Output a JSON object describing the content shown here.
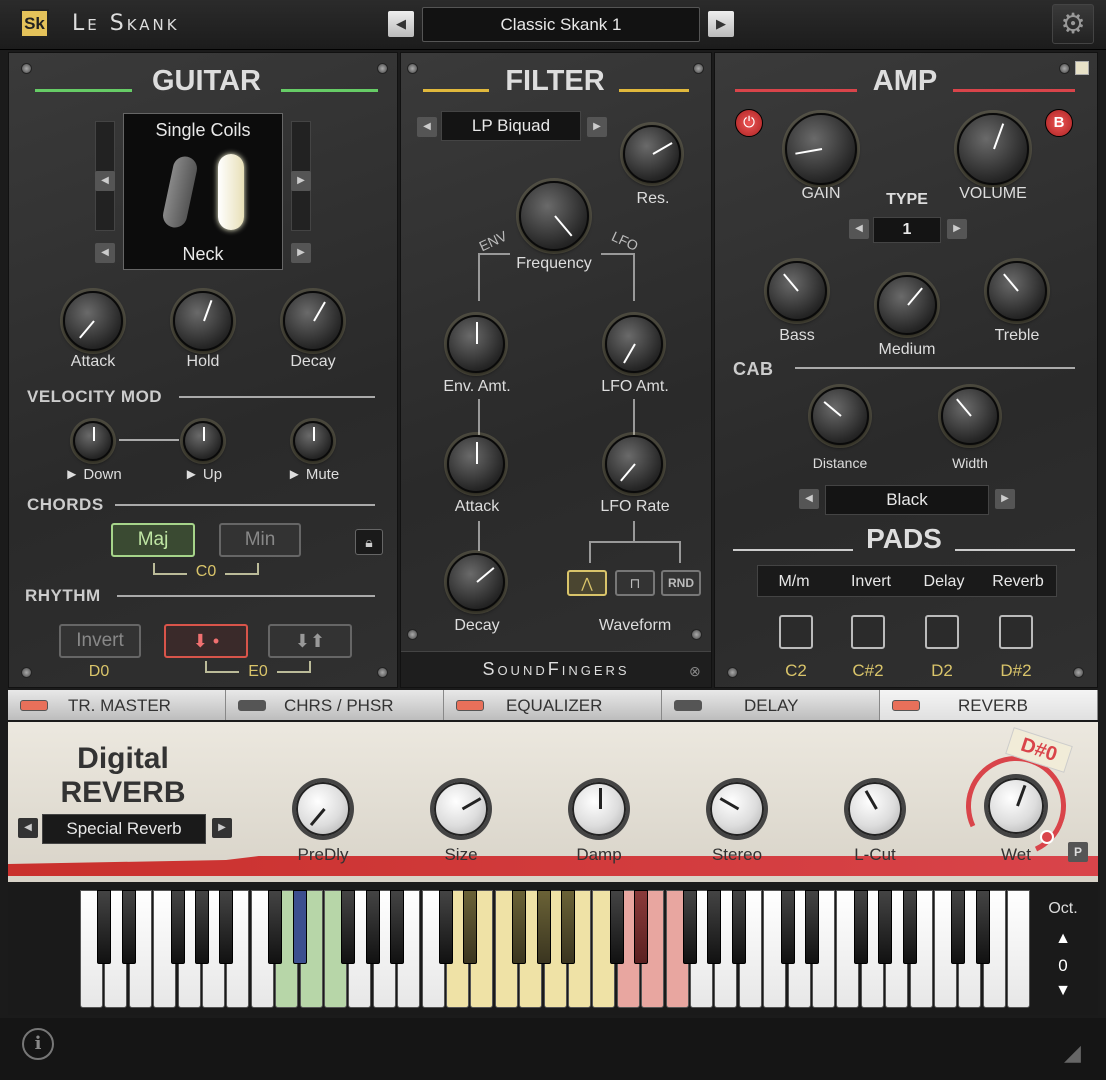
{
  "header": {
    "logo": "Sk",
    "app_title": "Le Skank",
    "preset": "Classic Skank 1",
    "prev": "◀",
    "next": "▶",
    "gear_icon": "gear-icon"
  },
  "guitar": {
    "title": "GUITAR",
    "pickup_type": "Single Coils",
    "pickup_position": "Neck",
    "knobs": [
      {
        "label": "Attack"
      },
      {
        "label": "Hold"
      },
      {
        "label": "Decay"
      }
    ],
    "velocity_mod": {
      "title": "VELOCITY MOD",
      "items": [
        "► Down",
        "► Up",
        "► Mute"
      ]
    },
    "chords": {
      "title": "CHORDS",
      "maj": "Maj",
      "min": "Min",
      "key": "C0"
    },
    "rhythm": {
      "title": "RHYTHM",
      "invert": "Invert",
      "invert_key": "D0",
      "strum_key": "E0"
    }
  },
  "filter": {
    "title": "FILTER",
    "type": "LP Biquad",
    "res": "Res.",
    "frequency": "Frequency",
    "env": "ENV",
    "lfo": "LFO",
    "env_amt": "Env. Amt.",
    "lfo_amt": "LFO Amt.",
    "attack": "Attack",
    "lfo_rate": "LFO Rate",
    "decay": "Decay",
    "waveform": "Waveform",
    "rnd": "RND",
    "brand": "SoundFingers"
  },
  "amp": {
    "title": "AMP",
    "b": "B",
    "gain": "GAIN",
    "volume": "VOLUME",
    "type_label": "TYPE",
    "type_value": "1",
    "bass": "Bass",
    "medium": "Medium",
    "treble": "Treble",
    "cab": "CAB",
    "distance": "Distance",
    "width": "Width",
    "cab_value": "Black"
  },
  "pads": {
    "title": "PADS",
    "tabs": [
      "M/m",
      "Invert",
      "Delay",
      "Reverb"
    ],
    "keys": [
      "C2",
      "C#2",
      "D2",
      "D#2"
    ]
  },
  "fx_tabs": [
    {
      "label": "TR. MASTER",
      "on": true
    },
    {
      "label": "CHRS / PHSR",
      "on": false
    },
    {
      "label": "EQUALIZER",
      "on": true
    },
    {
      "label": "DELAY",
      "on": false
    },
    {
      "label": "REVERB",
      "on": true
    }
  ],
  "reverb": {
    "title1": "Digital",
    "title2": "REVERB",
    "preset": "Special Reverb",
    "knobs": [
      "PreDly",
      "Size",
      "Damp",
      "Stereo",
      "L-Cut",
      "Wet"
    ],
    "tag": "D#0",
    "p": "P"
  },
  "keyboard": {
    "oct_label": "Oct.",
    "oct_value": "0",
    "up": "▲",
    "down": "▼"
  },
  "footer": {
    "info": "i"
  },
  "colors": {
    "green_zone": "#b7d6a8",
    "blue_zone": "#3c4f8f",
    "yellow_zone": "#efe2a6",
    "red_zone": "#e8a6a0",
    "accent_red": "#d9444a",
    "accent_gold": "#d9c46a"
  }
}
